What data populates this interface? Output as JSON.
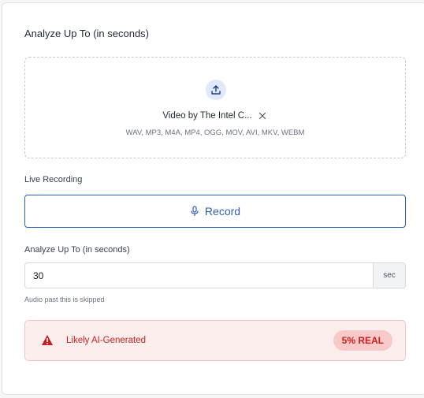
{
  "header": {
    "title": "Analyze Up To (in seconds)"
  },
  "upload": {
    "icon": "upload-icon",
    "file_name": "Video by The Intel C...",
    "remove_icon": "close-icon",
    "formats": "WAV, MP3, M4A, MP4, OGG, MOV, AVI, MKV, WEBM"
  },
  "live": {
    "label": "Live Recording",
    "record_label": "Record",
    "icon": "microphone-icon"
  },
  "analyze": {
    "label": "Analyze Up To (in seconds)",
    "value": "30",
    "unit": "sec",
    "hint": "Audio past this is skipped"
  },
  "result": {
    "icon": "warning-icon",
    "text": "Likely AI-Generated",
    "badge": "5% REAL"
  },
  "colors": {
    "accent": "#2f5fb3",
    "danger": "#c81e1e",
    "danger_bg": "#fdeeee"
  }
}
